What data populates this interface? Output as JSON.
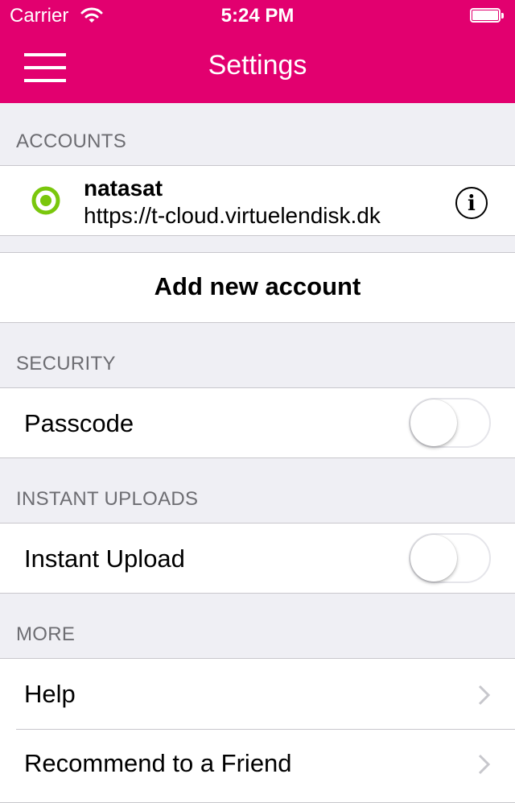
{
  "status_bar": {
    "carrier": "Carrier",
    "time": "5:24 PM",
    "wifi_icon": "wifi-icon",
    "battery_icon": "battery-icon"
  },
  "nav_bar": {
    "title": "Settings",
    "menu_icon": "hamburger-menu-icon",
    "background_color": "#e2006f"
  },
  "sections": {
    "accounts": {
      "header": "ACCOUNTS",
      "account": {
        "name": "natasat",
        "url": "https://t-cloud.virtuelendisk.dk",
        "status_icon": "active-account-icon",
        "status_color": "#7ac70c",
        "info_icon": "info-icon",
        "info_glyph": "i"
      },
      "add_account_label": "Add new account"
    },
    "security": {
      "header": "SECURITY",
      "passcode_label": "Passcode",
      "passcode_enabled": false
    },
    "instant_uploads": {
      "header": "INSTANT UPLOADS",
      "instant_upload_label": "Instant Upload",
      "instant_upload_enabled": false
    },
    "more": {
      "header": "MORE",
      "items": [
        {
          "label": "Help",
          "icon": "chevron-right-icon"
        },
        {
          "label": "Recommend to a Friend",
          "icon": "chevron-right-icon"
        }
      ]
    }
  }
}
